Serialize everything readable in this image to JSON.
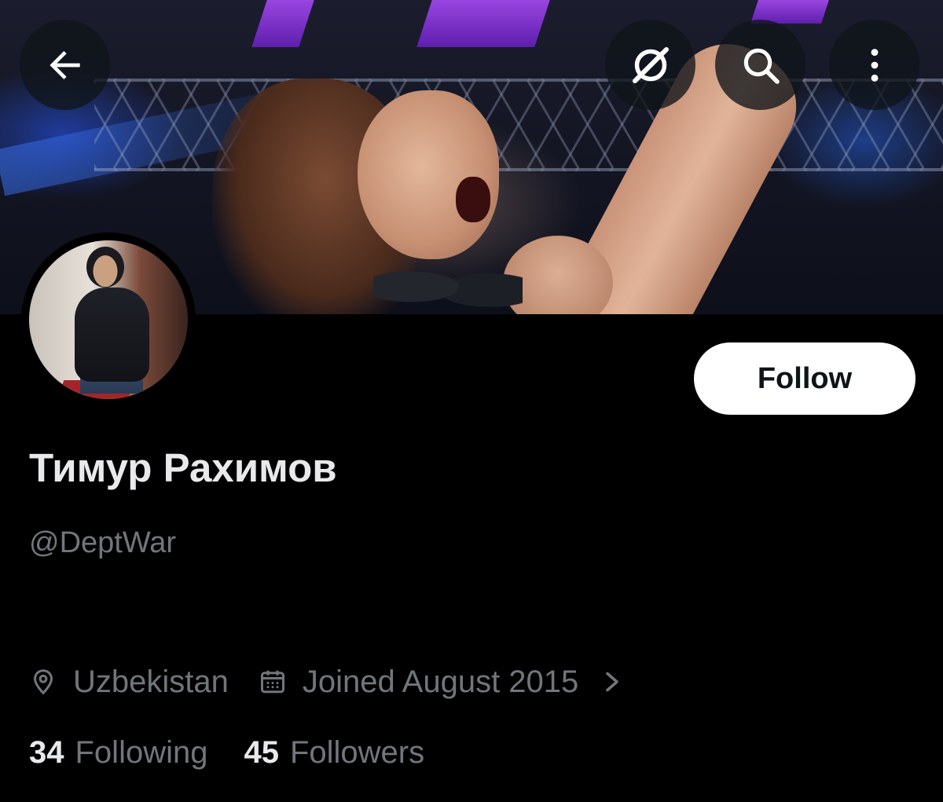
{
  "header": {
    "back_icon": "arrow-left-icon",
    "grok_icon": "grok-icon",
    "search_icon": "search-icon",
    "more_icon": "more-vertical-icon"
  },
  "profile": {
    "display_name": "Тимур Рахимов",
    "handle": "@DeptWar",
    "follow_label": "Follow",
    "location": "Uzbekistan",
    "joined": "Joined August 2015",
    "following_count": "34",
    "following_label": "Following",
    "followers_count": "45",
    "followers_label": "Followers"
  },
  "colors": {
    "background": "#000000",
    "primary_text": "#e7e9ea",
    "secondary_text": "#71767b",
    "follow_button_bg": "#ffffff"
  }
}
